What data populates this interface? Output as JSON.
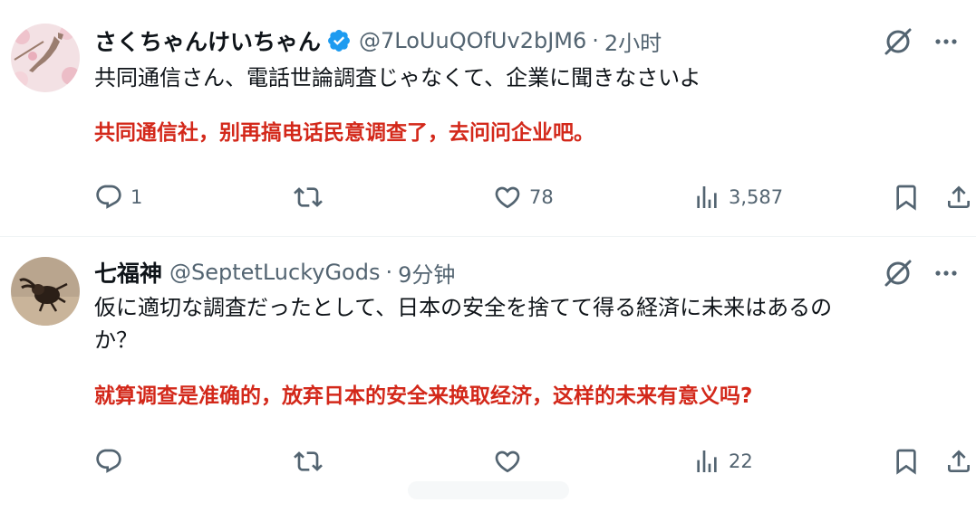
{
  "tweets": [
    {
      "name": "さくちゃんけいちゃん",
      "handle": "@7LoUuQOfUv2bJM6",
      "separator": "·",
      "time": "2小时",
      "verified": true,
      "text_lines": [
        "共同通信さん、電話世論調査じゃなくて、企業に聞きなさいよ"
      ],
      "translation": "共同通信社，别再搞电话民意调查了，去问问企业吧。",
      "replies": "1",
      "retweets": "",
      "likes": "78",
      "views": "3,587",
      "avatar_icon": "cherry-blossom-japan-map-avatar"
    },
    {
      "name": "七福神",
      "handle": "@SeptetLuckyGods",
      "separator": "·",
      "time": "9分钟",
      "verified": false,
      "text_lines": [
        "仮に適切な調査だったとして、日本の安全を捨てて得る経済に未来はあるの",
        "か？"
      ],
      "translation": "就算调查是准确的，放弃日本的安全来换取经济，这样的未来有意义吗?",
      "replies": "",
      "retweets": "",
      "likes": "",
      "views": "22",
      "avatar_icon": "stag-beetle-avatar"
    }
  ],
  "icons": {
    "reply": "reply-icon",
    "retweet": "retweet-icon",
    "like": "like-icon",
    "views": "views-icon",
    "bookmark": "bookmark-icon",
    "share": "share-icon",
    "grok": "grok-icon",
    "more": "more-icon",
    "verified": "verified-badge-icon"
  },
  "colors": {
    "text": "#0f1419",
    "secondary": "#536471",
    "translation": "#d3281a",
    "verified": "#1d9bf0",
    "divider": "#eff3f4"
  }
}
